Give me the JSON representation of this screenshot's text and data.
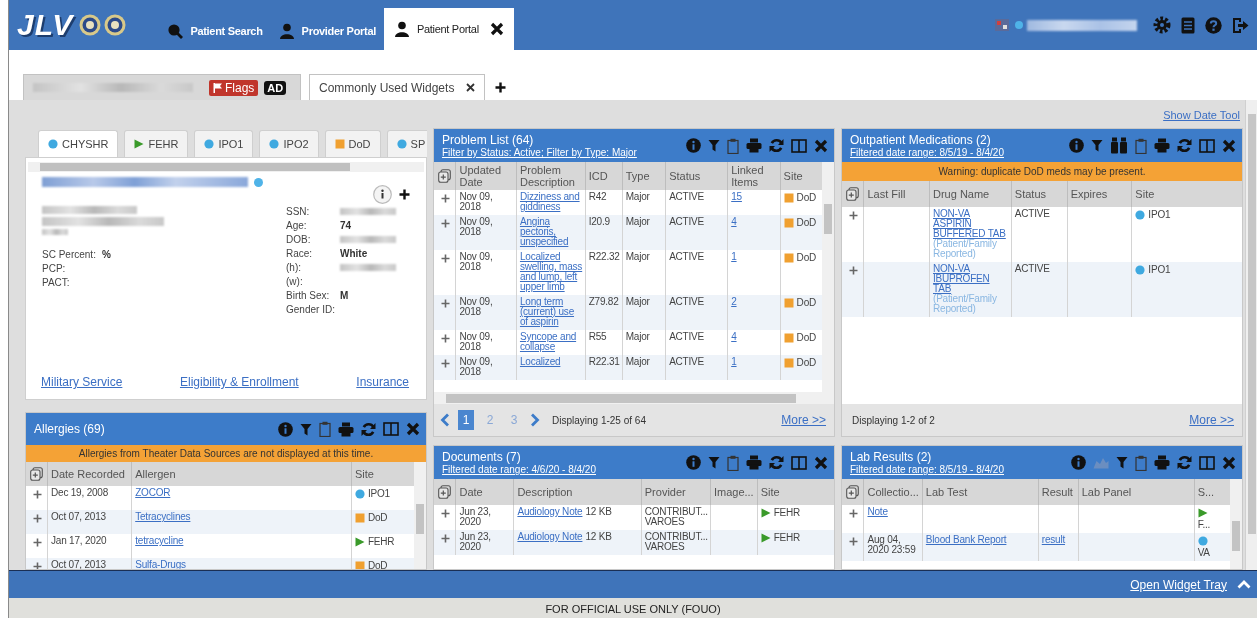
{
  "app": {
    "logo": "JLV"
  },
  "nav_tabs": [
    {
      "label": "Patient Search",
      "kind": "search",
      "selected": false,
      "closable": false
    },
    {
      "label": "Provider Portal",
      "kind": "provider",
      "selected": false,
      "closable": false
    },
    {
      "label": "Patient Portal",
      "kind": "patient",
      "selected": true,
      "closable": true
    }
  ],
  "patient_tabs": [
    {
      "kind": "patient",
      "selected": true,
      "flags": "Flags",
      "badge": "AD"
    },
    {
      "kind": "widgets",
      "label": "Commonly Used Widgets",
      "selected": false
    }
  ],
  "date_tool_link": "Show Date Tool",
  "patient_card": {
    "site_tabs": [
      {
        "label": "CHYSHR",
        "kind": "dot",
        "color": "#3fa9e0",
        "selected": true
      },
      {
        "label": "FEHR",
        "kind": "triangle",
        "color": "#3a9a2a",
        "selected": false
      },
      {
        "label": "IPO1",
        "kind": "dot",
        "color": "#3fa9e0",
        "selected": false
      },
      {
        "label": "IPO2",
        "kind": "dot",
        "color": "#3fa9e0",
        "selected": false
      },
      {
        "label": "DoD",
        "kind": "square",
        "color": "#f0a030",
        "selected": false
      },
      {
        "label": "SP",
        "kind": "dot",
        "color": "#3fa9e0",
        "selected": false
      }
    ],
    "left_fields": [
      {
        "label": "SC Percent:",
        "value": "%"
      },
      {
        "label": "PCP:"
      },
      {
        "label": "PACT:"
      }
    ],
    "right_fields": [
      {
        "label": "SSN:",
        "redacted": true
      },
      {
        "label": "Age:",
        "value": "74"
      },
      {
        "label": "DOB:",
        "redacted": true
      },
      {
        "label": "Race:",
        "value": "White"
      },
      {
        "label": "(h):",
        "redacted": true
      },
      {
        "label": "(w):"
      },
      {
        "label": "Birth Sex:",
        "value": "M"
      },
      {
        "label": "Gender ID:"
      }
    ],
    "links": [
      "Military Service",
      "Eligibility & Enrollment",
      "Insurance"
    ]
  },
  "widgets": [
    {
      "kind": "problems",
      "title": "Problem List (64)",
      "filter": "Filter by Status: Active; Filter by Type: Major",
      "columns": [
        "Updated Date",
        "Problem Description",
        "ICD",
        "Type",
        "Status",
        "Linked Items",
        "Site"
      ],
      "rows": [
        [
          "Nov 09, 2018",
          {
            "link": "Dizziness and giddiness"
          },
          "R42",
          "Major",
          "ACTIVE",
          {
            "link": "15"
          },
          {
            "site": "DoD",
            "kind": "square",
            "color": "#f0a030"
          }
        ],
        [
          "Nov 09, 2018",
          {
            "link": "Angina pectoris, unspecified"
          },
          "I20.9",
          "Major",
          "ACTIVE",
          {
            "link": "4"
          },
          {
            "site": "DoD",
            "kind": "square",
            "color": "#f0a030"
          }
        ],
        [
          "Nov 09, 2018",
          {
            "link": "Localized swelling, mass and lump, left upper limb"
          },
          "R22.32",
          "Major",
          "ACTIVE",
          {
            "link": "1"
          },
          {
            "site": "DoD",
            "kind": "square",
            "color": "#f0a030"
          }
        ],
        [
          "Nov 09, 2018",
          {
            "link": "Long term (current) use of aspirin"
          },
          "Z79.82",
          "Major",
          "ACTIVE",
          {
            "link": "2"
          },
          {
            "site": "DoD",
            "kind": "square",
            "color": "#f0a030"
          }
        ],
        [
          "Nov 09, 2018",
          {
            "link": "Syncope and collapse"
          },
          "R55",
          "Major",
          "ACTIVE",
          {
            "link": "4"
          },
          {
            "site": "DoD",
            "kind": "square",
            "color": "#f0a030"
          }
        ],
        [
          "Nov 09, 2018",
          {
            "link": "Localized"
          },
          "R22.31",
          "Major",
          "ACTIVE",
          {
            "link": "1"
          },
          {
            "site": "DoD",
            "kind": "square",
            "color": "#f0a030"
          }
        ]
      ],
      "pages": [
        {
          "label": "1",
          "selected": true
        },
        {
          "label": "2",
          "selected": false
        },
        {
          "label": "3",
          "selected": false
        }
      ],
      "summary": "Displaying 1-25 of 64",
      "more": "More >>"
    },
    {
      "kind": "meds",
      "title": "Outpatient Medications (2)",
      "filter": "Filtered date range: 8/5/19 - 8/4/20",
      "warning": "Warning: duplicate DoD meds may be present.",
      "columns": [
        "Last Fill",
        "Drug Name",
        "Status",
        "Expires",
        "Site"
      ],
      "rows": [
        [
          null,
          {
            "link": "NON-VA ASPIRIN BUFFERED TAB",
            "note": "(Patient/Family Reported)"
          },
          "ACTIVE",
          null,
          {
            "site": "IPO1",
            "kind": "dot",
            "color": "#3fa9e0"
          }
        ],
        [
          null,
          {
            "link": "NON-VA IBUPROFEN TAB",
            "note": "(Patient/Family Reported)"
          },
          "ACTIVE",
          null,
          {
            "site": "IPO1",
            "kind": "dot",
            "color": "#3fa9e0"
          }
        ]
      ],
      "summary": "Displaying 1-2 of 2",
      "more": "More >>"
    },
    {
      "kind": "allergies",
      "title": "Allergies (69)",
      "warning": "Allergies from Theater Data Sources are not displayed at this time.",
      "columns": [
        "Date Recorded",
        "Allergen",
        "Site"
      ],
      "rows": [
        [
          "Dec 19, 2008",
          {
            "link": "ZOCOR"
          },
          {
            "site": "IPO1",
            "kind": "dot",
            "color": "#3fa9e0"
          }
        ],
        [
          "Oct 07, 2013",
          {
            "link": "Tetracyclines"
          },
          {
            "site": "DoD",
            "kind": "square",
            "color": "#f0a030"
          }
        ],
        [
          "Jan 17, 2020",
          {
            "link": "tetracycline"
          },
          {
            "site": "FEHR",
            "kind": "triangle",
            "color": "#3a9a2a"
          }
        ],
        [
          "Oct 07, 2013",
          {
            "link": "Sulfa-Drugs"
          },
          {
            "site": "DoD",
            "kind": "square",
            "color": "#f0a030"
          }
        ]
      ]
    },
    {
      "kind": "documents",
      "title": "Documents (7)",
      "filter": "Filtered date range: 4/6/20 - 8/4/20",
      "columns": [
        "Date",
        "Description",
        "Provider",
        "Image...",
        "Site"
      ],
      "rows": [
        [
          "Jun 23, 2020",
          {
            "link": "Audiology Note",
            "after": "12 KB"
          },
          "CONTRIBUT...\nVAROES",
          null,
          {
            "site": "FEHR",
            "kind": "triangle",
            "color": "#3a9a2a"
          }
        ],
        [
          "Jun 23, 2020",
          {
            "link": "Audiology Note",
            "after": "12 KB"
          },
          "CONTRIBUT...\nVAROES",
          null,
          {
            "site": "FEHR",
            "kind": "triangle",
            "color": "#3a9a2a"
          }
        ]
      ]
    },
    {
      "kind": "labs",
      "title": "Lab Results (2)",
      "filter": "Filtered date range: 8/5/19 - 8/4/20",
      "columns": [
        "Collectio...",
        "Lab Test",
        "Result",
        "Lab Panel",
        "S..."
      ],
      "rows": [
        [
          {
            "link": "Note"
          },
          null,
          null,
          null,
          {
            "site": "F...",
            "kind": "triangle",
            "color": "#3a9a2a"
          }
        ],
        [
          "Aug 04, 2020 23:59",
          {
            "link": "Blood Bank Report"
          },
          {
            "link": "result"
          },
          null,
          {
            "site": "VA",
            "kind": "dot",
            "color": "#3fa9e0"
          }
        ]
      ]
    }
  ],
  "widget_tray": "Open Widget Tray",
  "footer": "FOR OFFICIAL USE ONLY (FOUO)"
}
